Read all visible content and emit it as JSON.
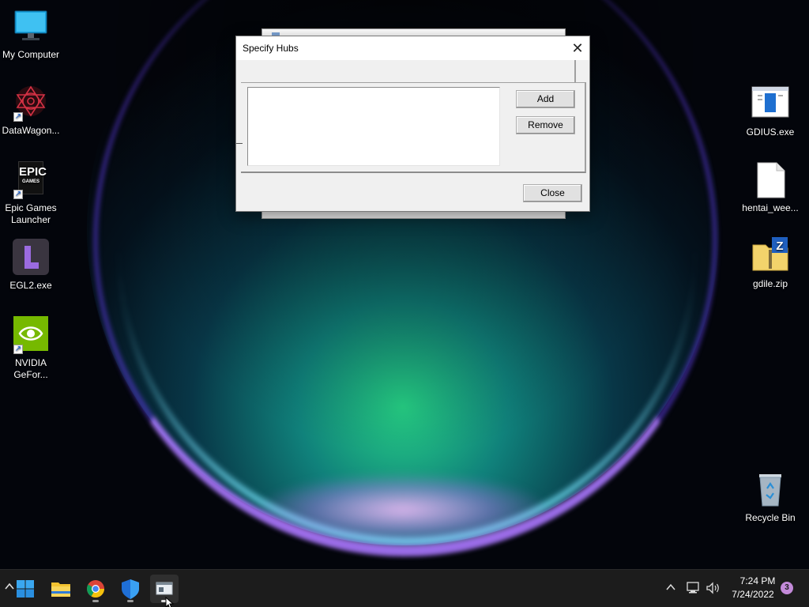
{
  "desktop": {
    "left_icons": [
      {
        "label": "My Computer",
        "icon": "monitor-icon"
      },
      {
        "label": "DataWagon...",
        "icon": "datawagon-icon"
      },
      {
        "label": "Epic Games Launcher",
        "icon": "epic-games-icon"
      },
      {
        "label": "EGL2.exe",
        "icon": "egl2-icon"
      },
      {
        "label": "NVIDIA GeFor...",
        "icon": "nvidia-icon"
      }
    ],
    "right_icons": [
      {
        "label": "GDIUS.exe",
        "icon": "exe-window-icon"
      },
      {
        "label": "hentai_wee...",
        "icon": "blank-file-icon"
      },
      {
        "label": "gdile.zip",
        "icon": "zip-folder-icon"
      },
      {
        "label": "Recycle Bin",
        "icon": "recycle-bin-icon"
      }
    ],
    "epic_logo_text": "EPIC",
    "epic_logo_sub": "GAMES"
  },
  "dialog": {
    "title": "Specify Hubs",
    "add_label": "Add",
    "remove_label": "Remove",
    "close_label": "Close",
    "close_glyph": "✕",
    "list_items": []
  },
  "taskbar": {
    "apps": [
      {
        "name": "start-button",
        "icon": "windows-start-icon"
      },
      {
        "name": "file-explorer",
        "icon": "folder-icon"
      },
      {
        "name": "chrome",
        "icon": "chrome-icon"
      },
      {
        "name": "windows-security",
        "icon": "shield-icon"
      },
      {
        "name": "active-app",
        "icon": "app-window-icon"
      }
    ],
    "time": "7:24 PM",
    "date": "7/24/2022",
    "notification_count": "3",
    "chevron_glyph": "^"
  },
  "colors": {
    "accent": "#0078d4",
    "notification_badge": "#c38ad9",
    "taskbar": "#1c1c1c",
    "dialog_bg": "#f0f0f0"
  }
}
